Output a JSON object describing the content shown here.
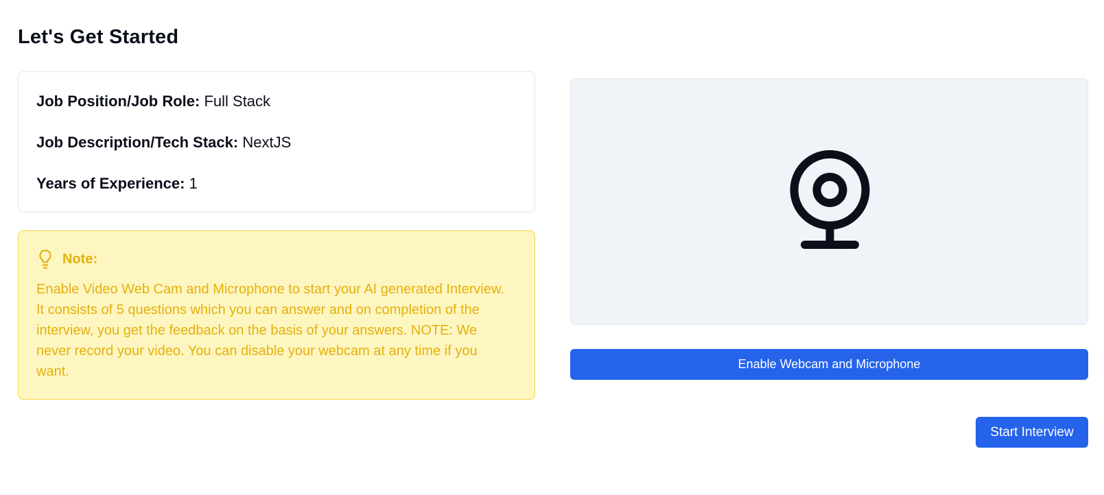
{
  "page": {
    "title": "Let's Get Started"
  },
  "job_details": {
    "position_label": "Job Position/Job Role:",
    "position_value": "Full Stack",
    "description_label": "Job Description/Tech Stack:",
    "description_value": "NextJS",
    "experience_label": "Years of Experience:",
    "experience_value": "1"
  },
  "note": {
    "icon": "lightbulb-icon",
    "title": "Note:",
    "body": "Enable Video Web Cam and Microphone to start your AI generated Interview. It consists of 5 questions which you can answer and on completion of the interview, you get the feedback on the basis of your answers. NOTE: We never record your video. You can disable your webcam at any time if you want."
  },
  "webcam": {
    "icon": "webcam-icon",
    "enable_button_label": "Enable Webcam and Microphone"
  },
  "actions": {
    "start_interview_label": "Start Interview"
  },
  "colors": {
    "primary": "#2563eb",
    "note_background": "#fef6c1",
    "note_text": "#e3b10d",
    "panel_background": "#f0f3f8"
  }
}
